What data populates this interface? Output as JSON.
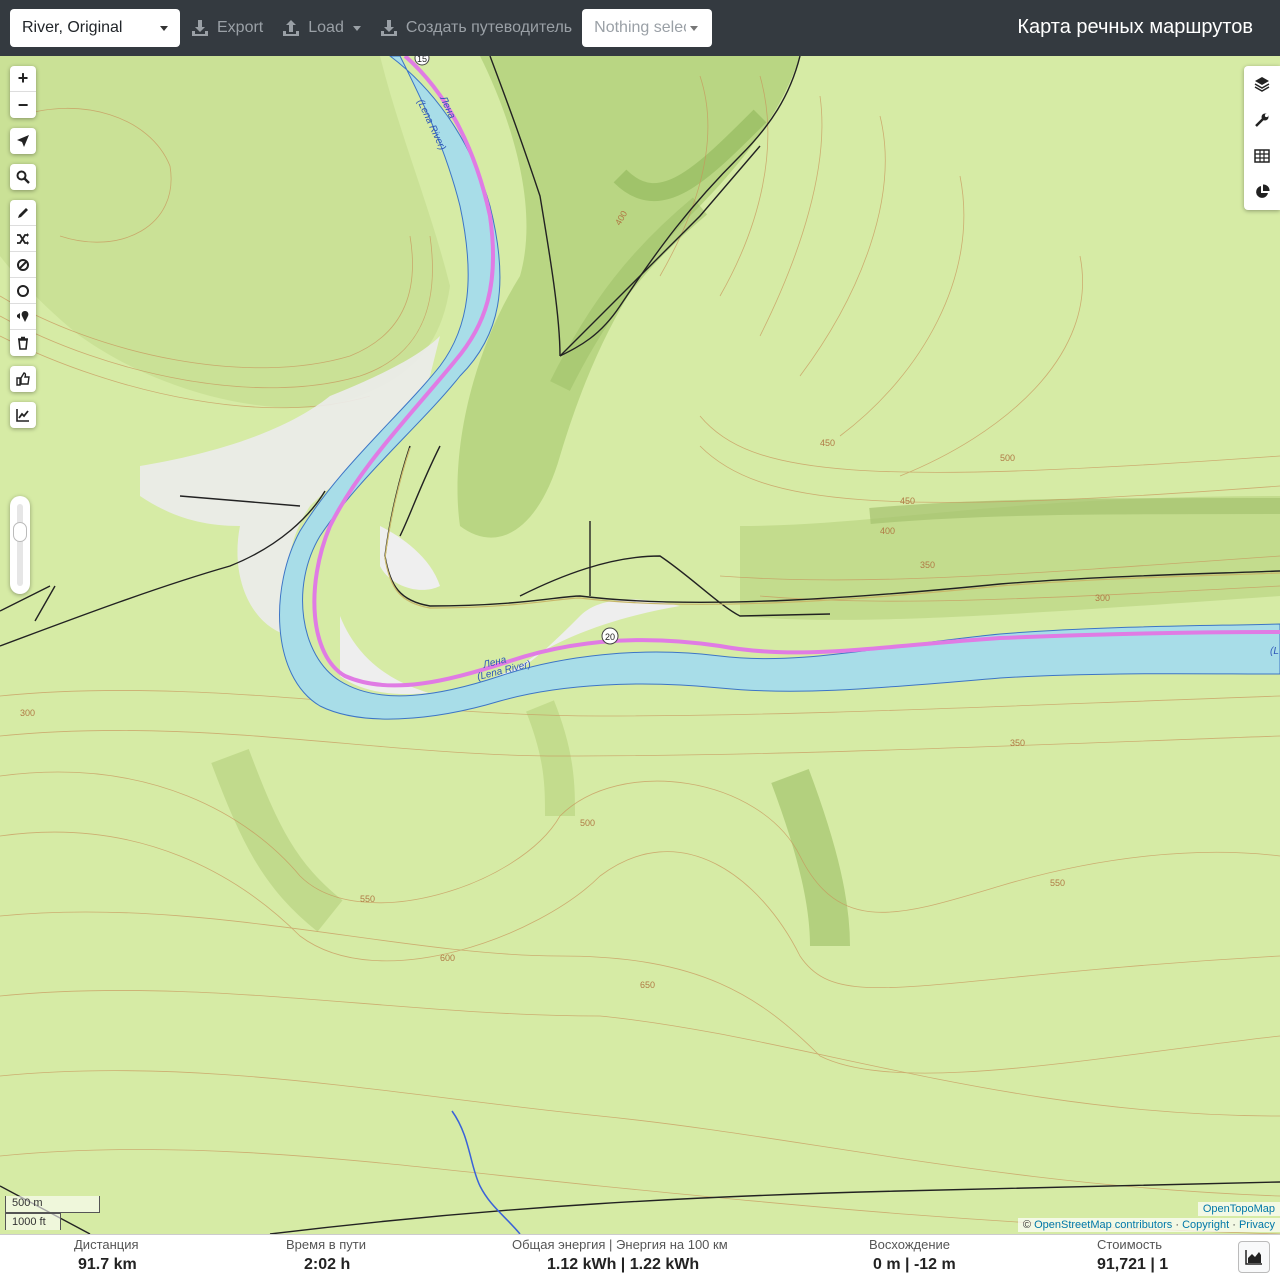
{
  "header": {
    "profile_value": "River, Original",
    "export_label": "Export",
    "load_label": "Load",
    "guide_label": "Создать путеводитель",
    "selection_placeholder": "Nothing selected",
    "app_title": "Карта речных маршрутов"
  },
  "map": {
    "river_label_ru": "Лена",
    "river_label_en": "(Lena River)",
    "river_label_short": "(L",
    "route_markers": [
      "15",
      "20"
    ],
    "contour_labels": [
      "300",
      "350",
      "400",
      "450",
      "500",
      "550",
      "600",
      "650"
    ],
    "scale_metric": "500 m",
    "scale_imperial": "1000 ft",
    "attribution_tiles": "OpenTopoMap",
    "attribution_prefix": "©",
    "attribution_osm": "OpenStreetMap contributors",
    "attribution_sep": "·",
    "attribution_copyright": "Copyright",
    "attribution_privacy": "Privacy"
  },
  "controls": {
    "zoom_in": "+",
    "zoom_out": "−"
  },
  "stats": {
    "distance_label": "Дистанция",
    "distance_value": "91.7 km",
    "time_label": "Время в пути",
    "time_value": "2:02 h",
    "energy_label": "Общая энергия | Энергия на 100 км",
    "energy_value": "1.12 kWh | 1.22 kWh",
    "ascent_label": "Восхождение",
    "ascent_value": "0 m | -12 m",
    "cost_label": "Стоимость",
    "cost_value": "91,721 | 1"
  },
  "colors": {
    "topbar": "#343a40",
    "terrain": "#d5eaa3",
    "river": "#a8dde8",
    "route": "#e87ee8",
    "contour": "#c8935a"
  }
}
